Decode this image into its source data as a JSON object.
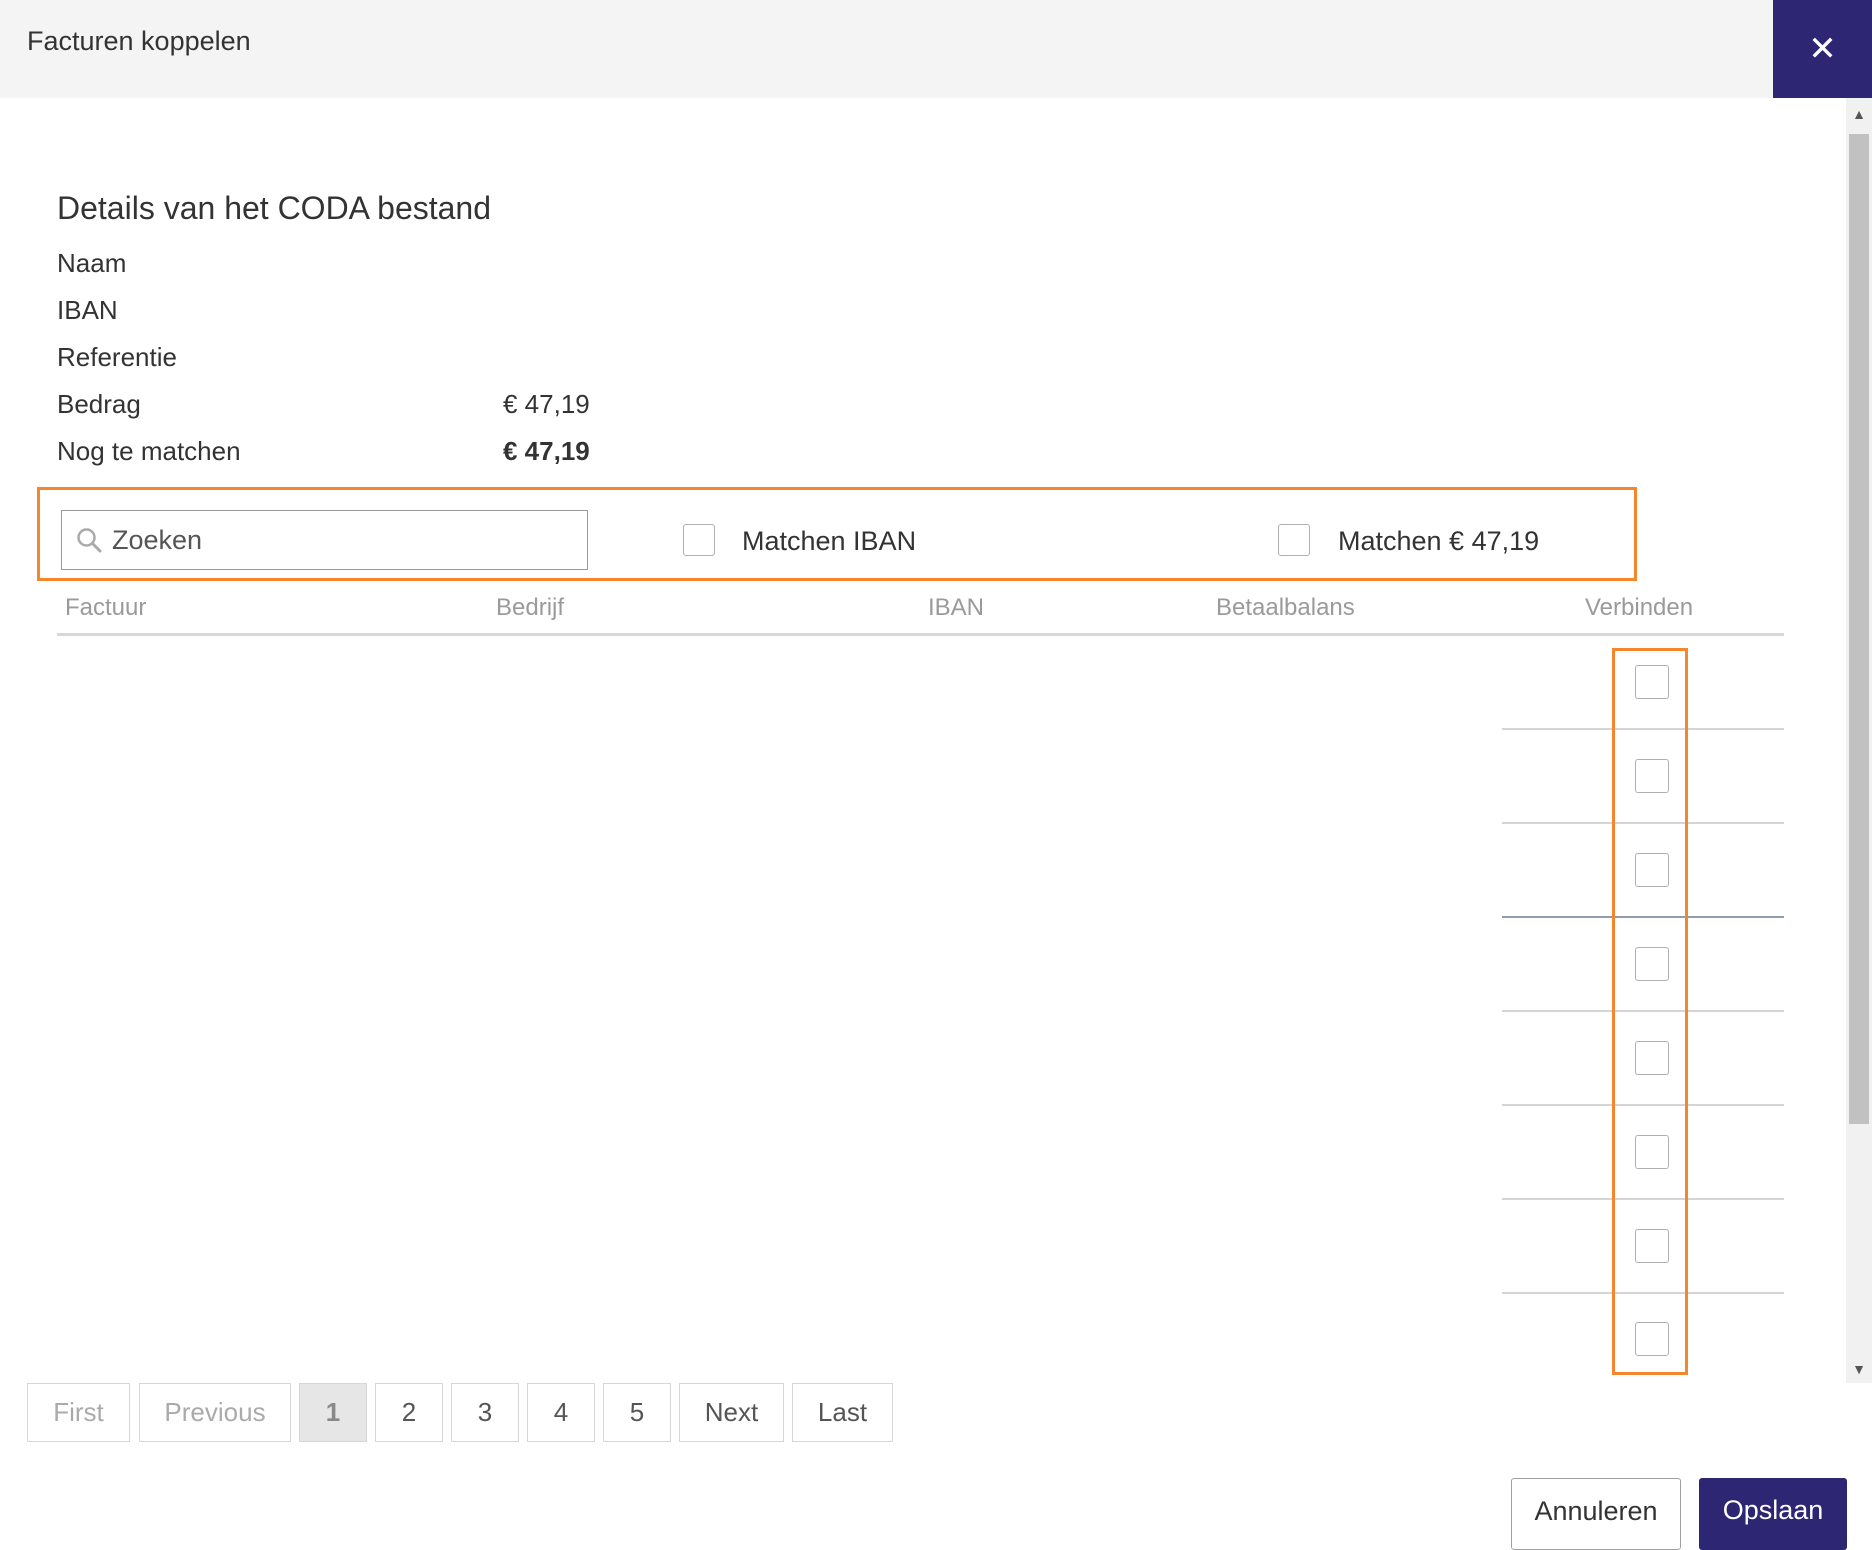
{
  "dialog": {
    "title": "Facturen koppelen",
    "close_icon": "close-icon"
  },
  "details": {
    "title": "Details van het CODA bestand",
    "rows": [
      {
        "label": "Naam",
        "value": ""
      },
      {
        "label": "IBAN",
        "value": ""
      },
      {
        "label": "Referentie",
        "value": ""
      },
      {
        "label": "Bedrag",
        "value": "€ 47,19"
      },
      {
        "label": "Nog te matchen",
        "value": "€ 47,19"
      }
    ]
  },
  "filters": {
    "search_placeholder": "Zoeken",
    "match_iban_label": "Matchen  IBAN",
    "match_amount_label": "Matchen € 47,19"
  },
  "table": {
    "headers": [
      "Factuur",
      "Bedrijf",
      "IBAN",
      "Betaalbalans",
      "Verbinden"
    ],
    "row_count": 8
  },
  "pagination": {
    "first": "First",
    "previous": "Previous",
    "pages": [
      "1",
      "2",
      "3",
      "4",
      "5"
    ],
    "current": "1",
    "next": "Next",
    "last": "Last"
  },
  "footer": {
    "cancel_label": "Annuleren",
    "save_label": "Opslaan"
  },
  "colors": {
    "primary": "#2d2672",
    "highlight": "#f5862b"
  }
}
